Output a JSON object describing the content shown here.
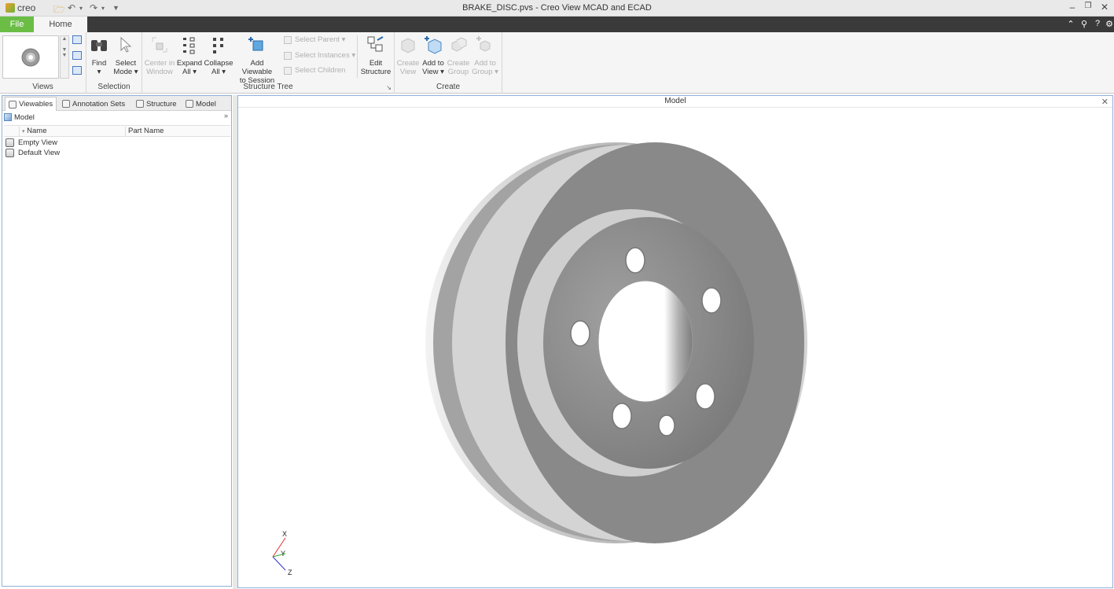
{
  "titlebar": {
    "app_logo_text": "creo",
    "title": "BRAKE_DISC.pvs - Creo View MCAD and ECAD"
  },
  "tabs": {
    "file": "File",
    "home": "Home"
  },
  "ribbon": {
    "views": {
      "label": "Views"
    },
    "selection": {
      "label": "Selection",
      "find": "Find",
      "select_mode_1": "Select",
      "select_mode_2": "Mode ▾"
    },
    "structure_tree": {
      "label": "Structure Tree",
      "center_1": "Center in",
      "center_2": "Window",
      "expand_1": "Expand",
      "expand_2": "All ▾",
      "collapse_1": "Collapse",
      "collapse_2": "All ▾",
      "add_viewable_1": "Add Viewable",
      "add_viewable_2": "to Session",
      "select_parent": "Select Parent ▾",
      "select_instances": "Select Instances ▾",
      "select_children": "Select Children",
      "edit_structure_1": "Edit",
      "edit_structure_2": "Structure"
    },
    "create": {
      "label": "Create",
      "create_view_1": "Create",
      "create_view_2": "View",
      "add_to_view_1": "Add to",
      "add_to_view_2": "View ▾",
      "create_group_1": "Create",
      "create_group_2": "Group",
      "add_to_group_1": "Add to",
      "add_to_group_2": "Group ▾"
    }
  },
  "left_panel": {
    "tabs": [
      "Viewables",
      "Annotation Sets",
      "Structure",
      "Model"
    ],
    "combo_value": "Model",
    "columns": [
      "Name",
      "Part Name"
    ],
    "rows": [
      "Empty View",
      "Default View"
    ]
  },
  "viewport": {
    "title": "Model",
    "axes": {
      "x": "X",
      "y": "Y",
      "z": "Z"
    }
  },
  "colors": {
    "file_tab": "#6bbd45",
    "tab_bar": "#3a3a3a",
    "panel_border": "#8fb1d9"
  }
}
